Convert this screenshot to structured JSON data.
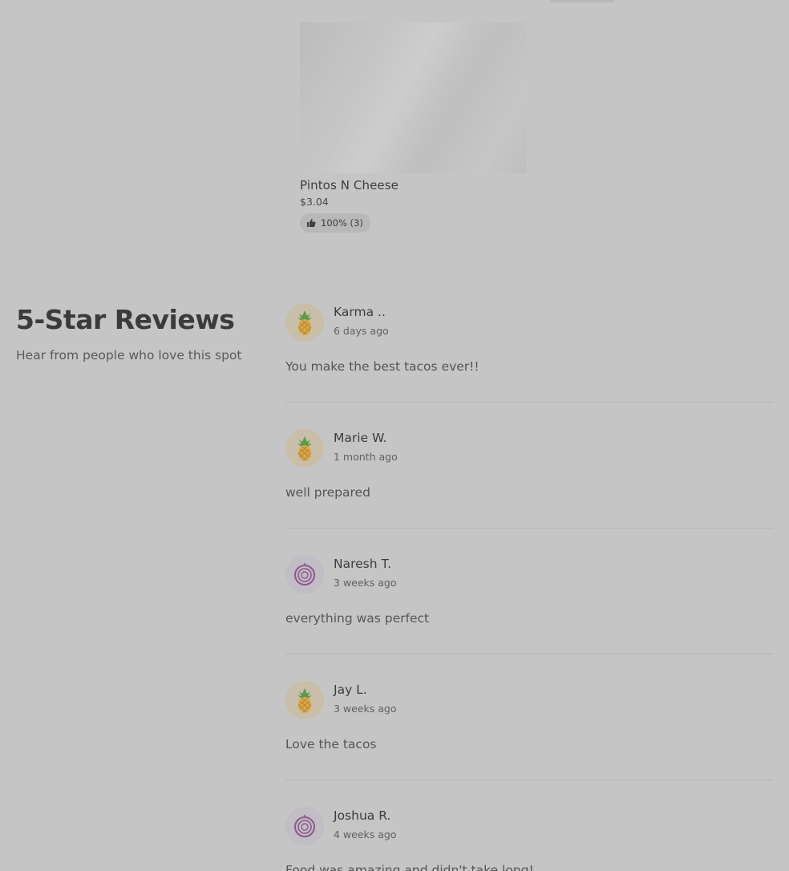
{
  "menu_item": {
    "name": "Pintos N Cheese",
    "price": "$3.04",
    "rating": "100% (3)",
    "rating_icon": "thumbs-up-icon"
  },
  "reviews_section": {
    "title": "5-Star Reviews",
    "subtitle": "Hear from people who love this spot"
  },
  "reviews": [
    {
      "name": "Karma ..",
      "time": "6 days ago",
      "text": "You make the best tacos ever!!",
      "avatar": "pineapple-icon"
    },
    {
      "name": "Marie W.",
      "time": "1 month ago",
      "text": "well prepared",
      "avatar": "pineapple-icon"
    },
    {
      "name": "Naresh T.",
      "time": "3 weeks ago",
      "text": "everything was perfect",
      "avatar": "onion-icon"
    },
    {
      "name": "Jay L.",
      "time": "3 weeks ago",
      "text": "Love the tacos",
      "avatar": "pineapple-icon"
    },
    {
      "name": "Joshua R.",
      "time": "4 weeks ago",
      "text": "Food was amazing and didn't take long!",
      "avatar": "onion-icon"
    }
  ],
  "colors": {
    "overlay_background": "#c5c5c5",
    "pineapple_avatar_bg": "#c9bfa8",
    "onion_avatar_bg": "#c2bcc5"
  }
}
